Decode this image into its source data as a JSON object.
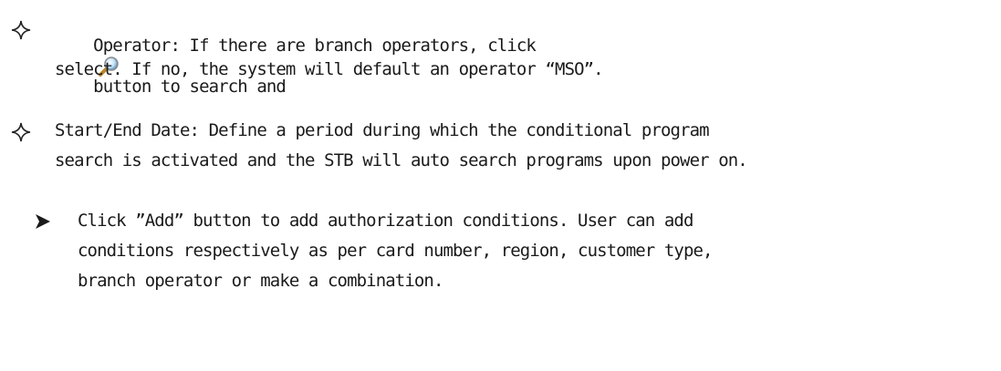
{
  "bullets": [
    {
      "icon": "diamond-star-bullet",
      "line1_a": "Operator: If there are branch operators, click",
      "icon_name": "magnifier-icon",
      "line1_b": "button to search and",
      "line2": "select. If no, the system will default an operator “MSO”."
    },
    {
      "icon": "diamond-star-bullet",
      "line1": "Start/End Date: Define a period during which the conditional program",
      "line2": "search is activated and the STB will auto search programs upon power on."
    },
    {
      "icon": "arrowhead-bullet",
      "line1": "Click ”Add” button to add authorization conditions. User can add",
      "line2": "conditions respectively as per card number, region, customer type,",
      "line3": "branch operator or make a combination."
    }
  ]
}
